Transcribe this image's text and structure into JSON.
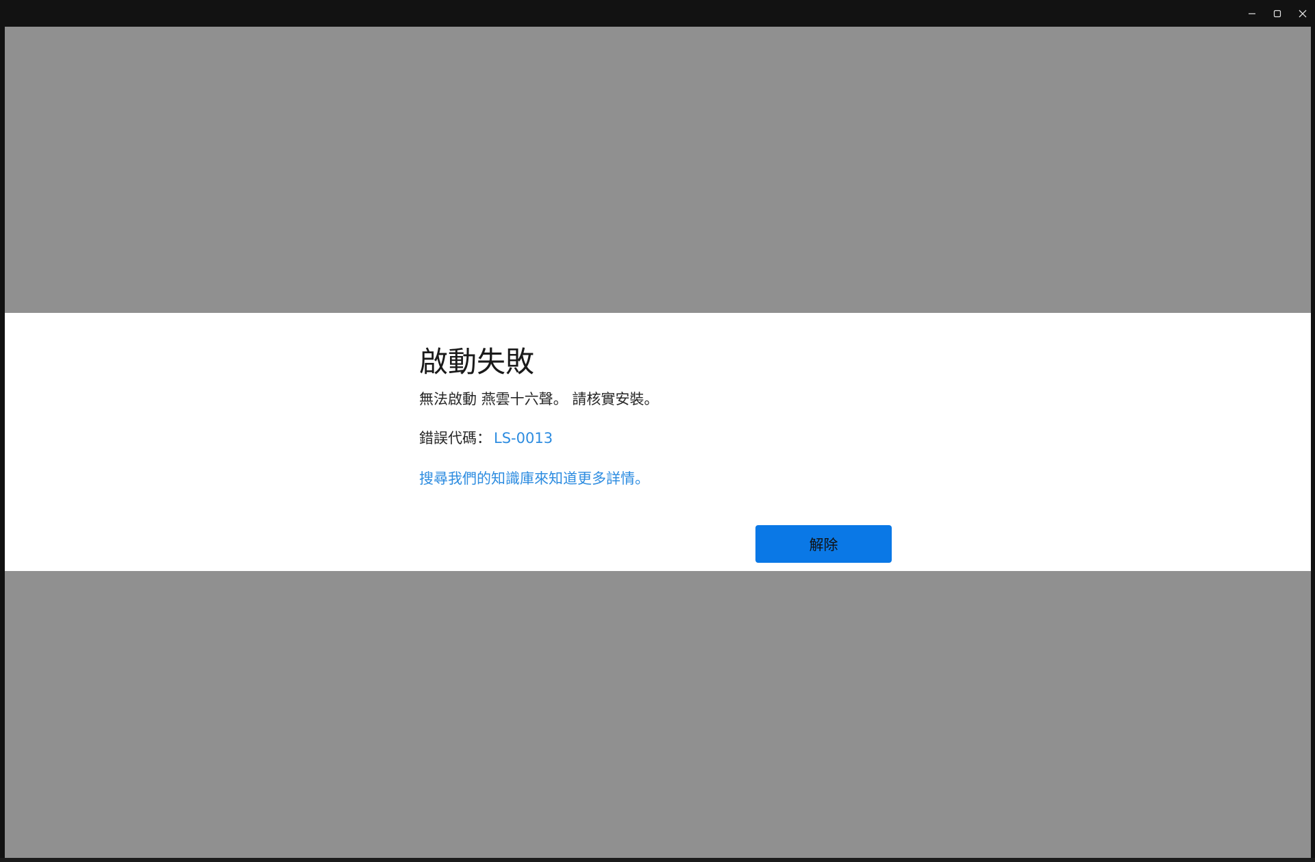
{
  "window": {
    "controls": {
      "minimize_icon": "minimize-icon",
      "maximize_icon": "maximize-icon",
      "close_icon": "close-icon"
    }
  },
  "dialog": {
    "title": "啟動失敗",
    "message": "無法啟動 燕雲十六聲。 請核實安裝。",
    "error_label": "錯誤代碼：",
    "error_code": "LS-0013",
    "kb_link": "搜尋我們的知識庫來知道更多詳情。",
    "dismiss_label": "解除"
  },
  "colors": {
    "overlay": "#909090",
    "link": "#2d8ce0",
    "button": "#0a78e6",
    "titlebar": "#121212"
  }
}
